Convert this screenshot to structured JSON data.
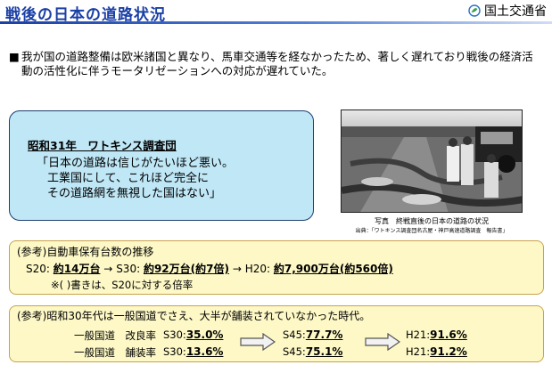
{
  "header": {
    "title": "戦後の日本の道路状況",
    "ministry": "国土交通省",
    "ministry_icon": "leaf-logo-icon"
  },
  "lead": {
    "bullet": "■",
    "text": "我が国の道路整備は欧米諸国と異なり、馬車交通等を経なかったため、著しく遅れており戦後の経済活動の活性化に伴うモータリゼーションへの対応が遅れていた。"
  },
  "callout": {
    "heading": "昭和31年　ワトキンス調査団",
    "quote_lines": [
      "「日本の道路は信じがたいほど悪い。",
      "工業国にして、これほど完全に",
      "その道路網を無視した国はない」"
    ],
    "border_color": "#1c3f6e",
    "fill_color": "#bfe7f6"
  },
  "photo": {
    "caption": "写真　終戦直後の日本の道路の状況",
    "source": "出典：「ワトキンス調査団名古屋・神戸高速道路調査　報告書」"
  },
  "vehicles": {
    "heading": "(参考)自動車保有台数の推移",
    "s20_label": "S20:",
    "s20_value": "約14万台",
    "arrow1": "→",
    "s30_label": "S30:",
    "s30_value": "約92万台(約7倍)",
    "arrow2": "→",
    "h20_label": "H20:",
    "h20_value": "約7,900万台(約560倍)",
    "note": "※(  )書きは、S20に対する倍率"
  },
  "roads": {
    "heading": "(参考)昭和30年代は一般国道でさえ、大半が舗装されていなかった時代。",
    "row1_label": "一般国道　改良率",
    "row2_label": "一般国道　舗装率",
    "row1_s30_label": "S30:",
    "row1_s30": "35.0%",
    "row2_s30_label": "S30:",
    "row2_s30": "13.6%",
    "row1_s45_label": "S45:",
    "row1_s45": "77.7%",
    "row2_s45_label": "S45:",
    "row2_s45": "75.1%",
    "row1_h21_label": "H21:",
    "row1_h21": "91.6%",
    "row2_h21_label": "H21:",
    "row2_h21": "91.2%"
  },
  "colors": {
    "title_blue": "#1a3fa6",
    "box_fill": "#fdf8c6",
    "box_border": "#c7a24c"
  }
}
